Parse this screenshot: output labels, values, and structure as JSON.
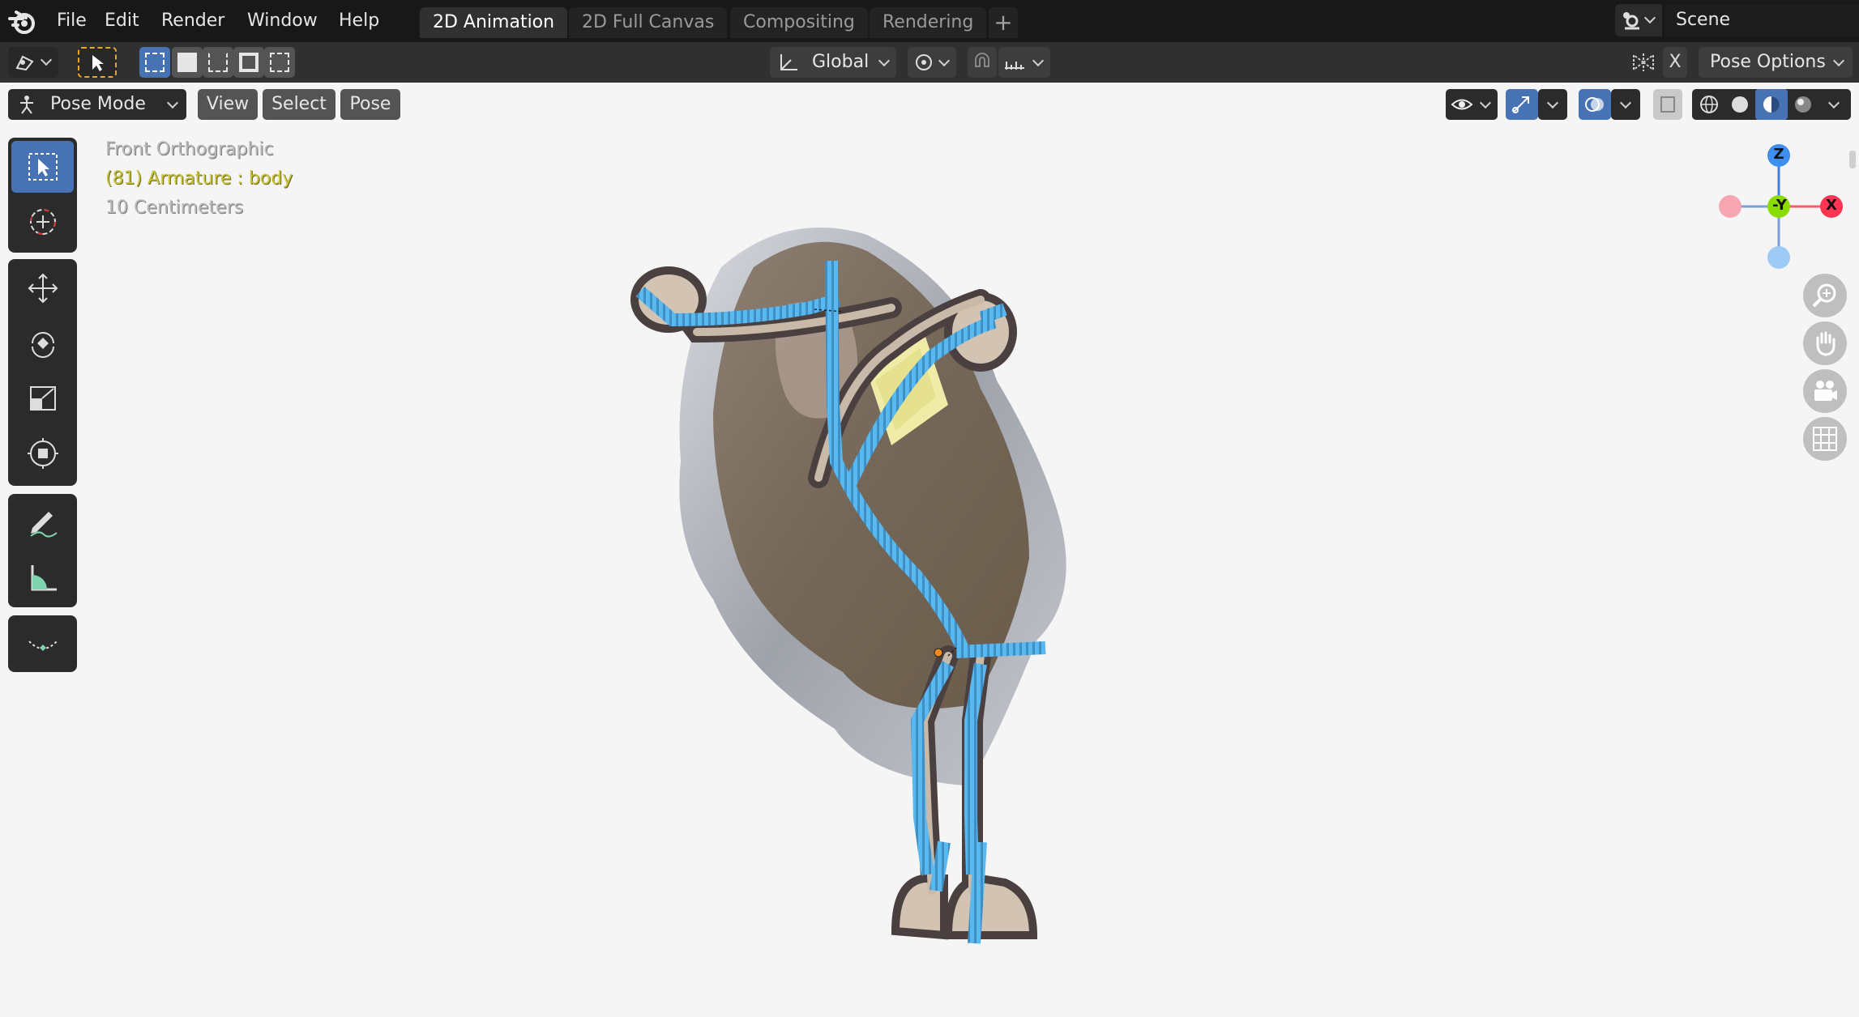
{
  "menu": {
    "items": [
      "File",
      "Edit",
      "Render",
      "Window",
      "Help"
    ]
  },
  "workspaces": {
    "tabs": [
      "2D Animation",
      "2D Full Canvas",
      "Compositing",
      "Rendering"
    ],
    "active": "2D Animation",
    "add_label": "+"
  },
  "scene": {
    "name": "Scene"
  },
  "tool_header": {
    "transform_orientation": "Global",
    "x_label": "X",
    "pose_options_label": "Pose Options"
  },
  "view_header": {
    "mode": "Pose Mode",
    "menus": [
      "View",
      "Select",
      "Pose"
    ]
  },
  "viewport": {
    "view_name": "Front Orthographic",
    "object_info": "(81) Armature : body",
    "scale_info": "10 Centimeters"
  },
  "gizmo": {
    "z_label": "Z",
    "y_label": "-Y",
    "x_label": "X"
  },
  "colors": {
    "accent": "#4772b3",
    "bone": "#4fb8ff",
    "info_yellow": "#c8c23a",
    "x_axis": "#ff3352",
    "y_axis": "#8bdc00",
    "z_axis": "#2890ff"
  },
  "icons": {
    "tools": [
      "select-box-icon",
      "cursor-icon",
      "move-icon",
      "rotate-icon",
      "scale-icon",
      "transform-icon",
      "annotate-icon",
      "measure-icon",
      "relax-icon"
    ],
    "nav": [
      "zoom-icon",
      "pan-hand-icon",
      "camera-icon",
      "ortho-grid-icon"
    ]
  }
}
